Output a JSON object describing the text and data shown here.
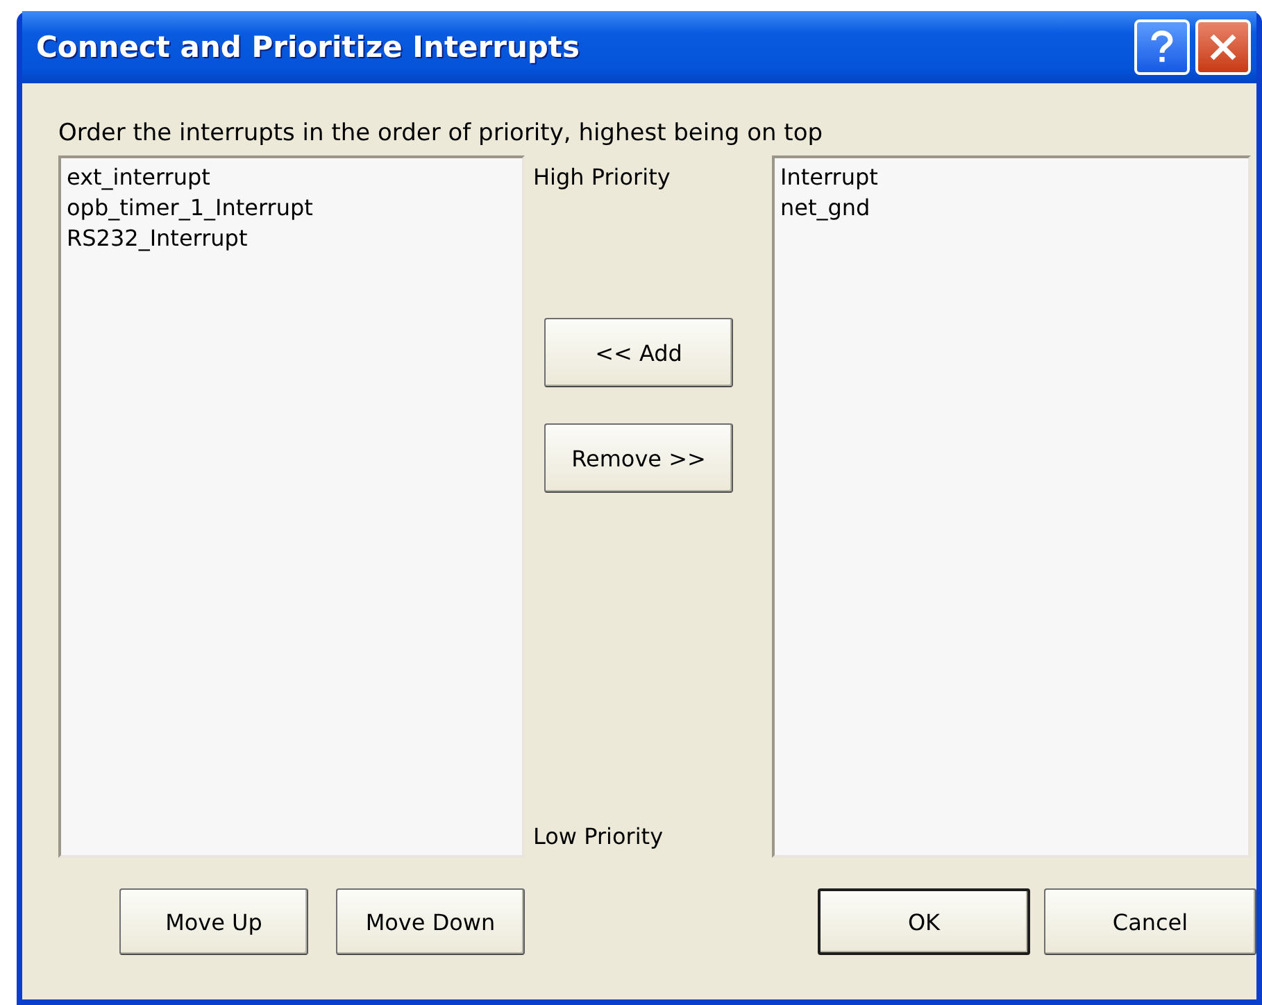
{
  "window": {
    "title": "Connect and Prioritize Interrupts"
  },
  "instruction": "Order the interrupts in the order of priority, highest being on top",
  "available_list": {
    "items": [
      "ext_interrupt",
      "opb_timer_1_Interrupt",
      "RS232_Interrupt"
    ]
  },
  "priority_labels": {
    "high": "High Priority",
    "low": "Low Priority"
  },
  "transfer_buttons": [
    "<< Add",
    "Remove >>"
  ],
  "connected_list": {
    "items": [
      "Interrupt",
      "net_gnd"
    ]
  },
  "order_buttons": [
    "Move Up",
    "Move Down"
  ],
  "dialog_buttons": [
    {
      "label": "OK",
      "default": true
    },
    {
      "label": "Cancel",
      "default": false
    }
  ]
}
